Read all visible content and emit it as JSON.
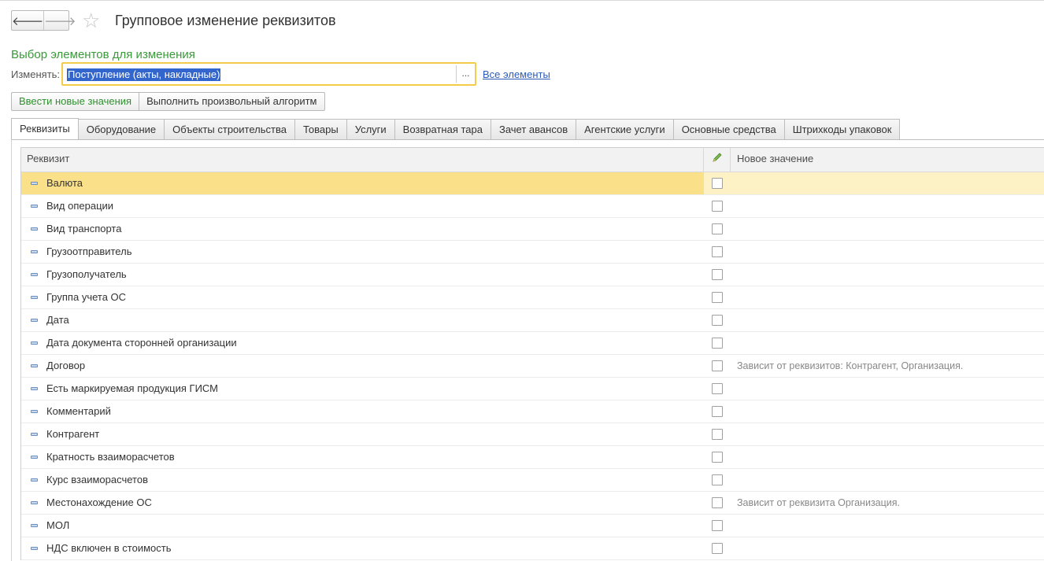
{
  "nav": {
    "back_glyph": "🡐",
    "forward_glyph": "🡒",
    "star_glyph": "☆"
  },
  "window": {
    "title": "Групповое изменение реквизитов"
  },
  "selection": {
    "section_title": "Выбор элементов для изменения",
    "change_label": "Изменять:",
    "change_value": "Поступление (акты, накладные)",
    "dots": "...",
    "all_elements_link": "Все элементы"
  },
  "actions": {
    "enter_new_values": "Ввести новые значения",
    "run_algorithm": "Выполнить произвольный алгоритм"
  },
  "tabs": [
    "Реквизиты",
    "Оборудование",
    "Объекты строительства",
    "Товары",
    "Услуги",
    "Возвратная тара",
    "Зачет авансов",
    "Агентские услуги",
    "Основные средства",
    "Штрихкоды упаковок"
  ],
  "table": {
    "headers": {
      "attribute": "Реквизит",
      "new_value": "Новое значение"
    },
    "rows": [
      {
        "name": "Валюта",
        "note": ""
      },
      {
        "name": "Вид операции",
        "note": ""
      },
      {
        "name": "Вид транспорта",
        "note": ""
      },
      {
        "name": "Грузоотправитель",
        "note": ""
      },
      {
        "name": "Грузополучатель",
        "note": ""
      },
      {
        "name": "Группа учета ОС",
        "note": ""
      },
      {
        "name": "Дата",
        "note": ""
      },
      {
        "name": "Дата документа сторонней организации",
        "note": ""
      },
      {
        "name": "Договор",
        "note": "Зависит от реквизитов: Контрагент, Организация."
      },
      {
        "name": "Есть маркируемая продукция ГИСМ",
        "note": ""
      },
      {
        "name": "Комментарий",
        "note": ""
      },
      {
        "name": "Контрагент",
        "note": ""
      },
      {
        "name": "Кратность взаиморасчетов",
        "note": ""
      },
      {
        "name": "Курс взаиморасчетов",
        "note": ""
      },
      {
        "name": "Местонахождение ОС",
        "note": "Зависит от реквизита Организация."
      },
      {
        "name": "МОЛ",
        "note": ""
      },
      {
        "name": "НДС включен в стоимость",
        "note": ""
      }
    ]
  }
}
